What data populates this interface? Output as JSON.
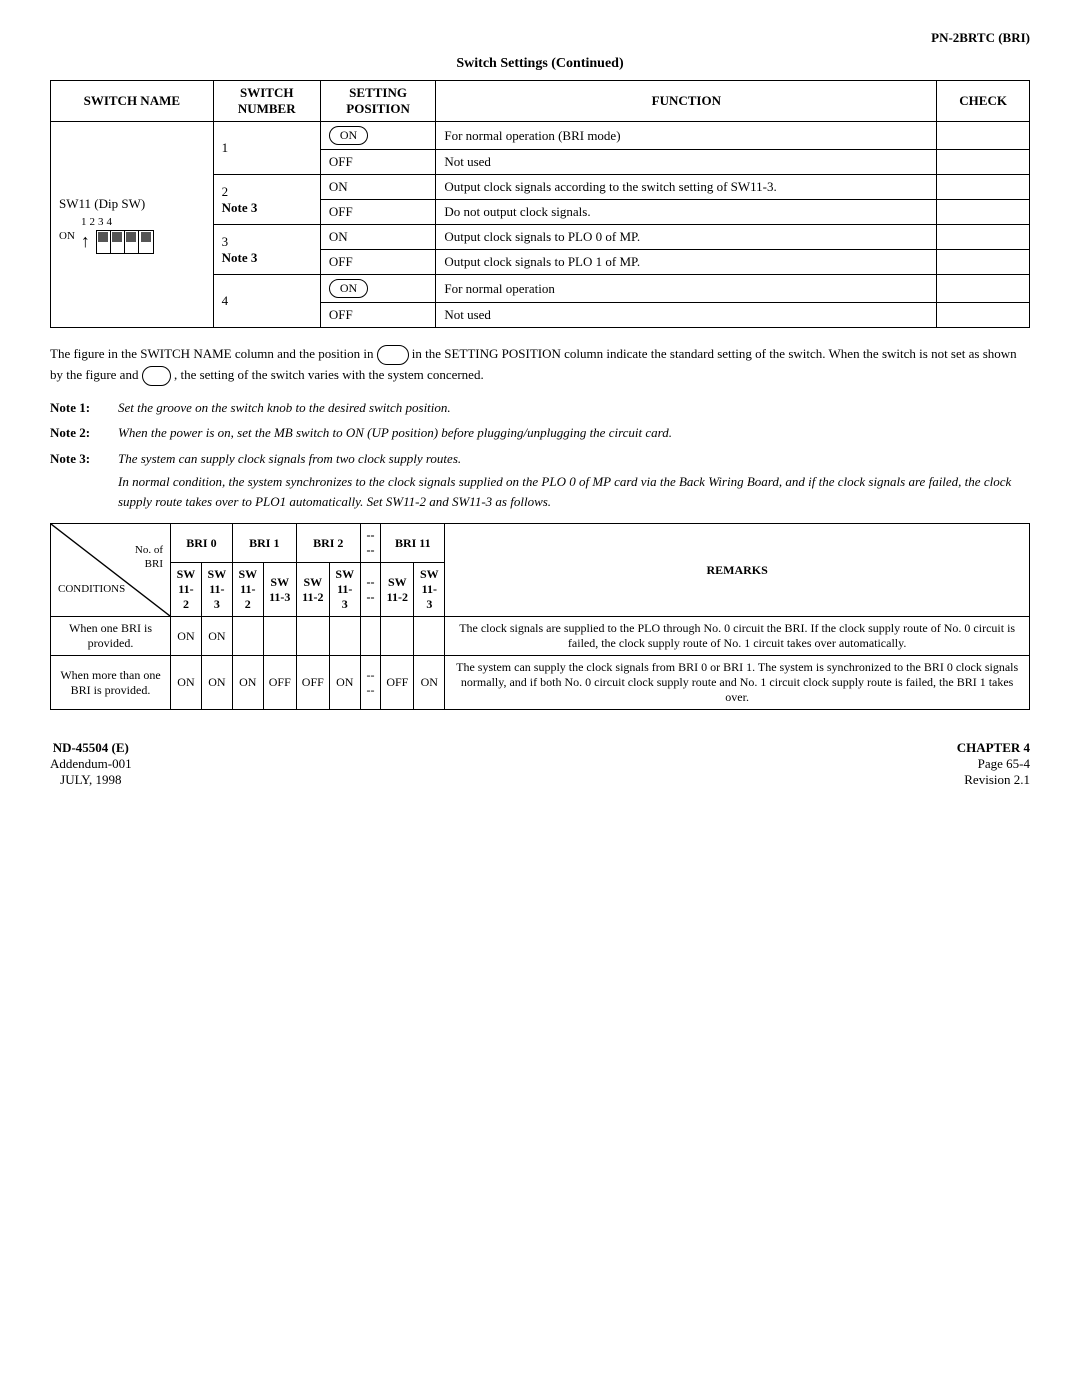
{
  "header": {
    "title": "PN-2BRTC (BRI)"
  },
  "section_title": "Switch Settings (Continued)",
  "switch_table": {
    "headers": [
      "SWITCH NAME",
      "SWITCH NUMBER",
      "SETTING POSITION",
      "FUNCTION",
      "CHECK"
    ],
    "switch_name": "SW11 (Dip SW)",
    "rows": [
      {
        "number": "1",
        "number_note": "",
        "positions": [
          {
            "pos": "ON",
            "circled": true,
            "function": "For normal operation (BRI mode)"
          },
          {
            "pos": "OFF",
            "circled": false,
            "function": "Not used"
          }
        ]
      },
      {
        "number": "2",
        "number_note": "Note 3",
        "positions": [
          {
            "pos": "ON",
            "circled": false,
            "function": "Output clock signals according to the switch setting of SW11-3."
          },
          {
            "pos": "OFF",
            "circled": false,
            "function": "Do not output clock signals."
          }
        ]
      },
      {
        "number": "3",
        "number_note": "Note 3",
        "positions": [
          {
            "pos": "ON",
            "circled": false,
            "function": "Output clock signals to PLO 0 of MP."
          },
          {
            "pos": "OFF",
            "circled": false,
            "function": "Output clock signals to PLO 1 of MP."
          }
        ]
      },
      {
        "number": "4",
        "number_note": "",
        "positions": [
          {
            "pos": "ON",
            "circled": true,
            "function": "For normal operation"
          },
          {
            "pos": "OFF",
            "circled": false,
            "function": "Not used"
          }
        ]
      }
    ]
  },
  "footnote_para": "The figure in the SWITCH NAME column and the position in",
  "footnote_para2": "in the SETTING POSITION column indicate the standard setting of the switch. When the switch is not set as shown by the figure and",
  "footnote_para3": ", the setting of the switch varies with the system concerned.",
  "notes": [
    {
      "label": "Note 1:",
      "text": "Set the groove on the switch knob to the desired switch position."
    },
    {
      "label": "Note 2:",
      "text": "When the power is on, set the MB switch to ON (UP position) before plugging/unplugging the circuit card."
    },
    {
      "label": "Note 3:",
      "text_line1": "The system can supply clock signals from two clock supply routes.",
      "text_line2": "In normal condition, the system synchronizes to the clock signals supplied on the PLO 0 of MP card via the Back Wiring Board, and if the clock signals are failed, the clock supply route takes over to PLO1 automatically. Set SW11-2 and SW11-3 as follows."
    }
  ],
  "bri_table": {
    "diagonal_top": "No. of BRI",
    "diagonal_bottom": "CONDITIONS",
    "sw_label": "SW",
    "groups": [
      {
        "label": "BRI  0",
        "col1": "SW\n11-2",
        "col2": "SW\n11-3"
      },
      {
        "label": "BRI  1",
        "col1": "SW\n11-2",
        "col2": "SW\n11-3"
      },
      {
        "label": "BRI  2",
        "col1": "SW\n11-2",
        "col2": "SW\n11-3"
      },
      {
        "label": "----",
        "col1": "----",
        "col2": null
      },
      {
        "label": "BRI  11",
        "col1": "SW\n11-2",
        "col2": "SW\n11-3"
      }
    ],
    "remarks_header": "REMARKS",
    "rows": [
      {
        "condition": "When one BRI is provided.",
        "bri0_sw112": "ON",
        "bri0_sw113": "ON",
        "bri1_sw112": "",
        "bri1_sw113": "",
        "bri2_sw112": "",
        "bri2_sw113": "",
        "dash": "",
        "bri11_sw112": "",
        "bri11_sw113": "",
        "remarks": "The clock signals are supplied to the PLO through No. 0 circuit the BRI. If the clock supply route of No. 0 circuit is failed, the clock supply route of No. 1 circuit takes over automatically."
      },
      {
        "condition": "When more than one BRI is provided.",
        "bri0_sw112": "ON",
        "bri0_sw113": "ON",
        "bri1_sw112": "ON",
        "bri1_sw113": "OFF",
        "bri2_sw112": "OFF",
        "bri2_sw113": "ON",
        "dash": "----",
        "bri11_sw112": "OFF",
        "bri11_sw113": "ON",
        "remarks": "The system can supply the clock signals from BRI 0 or BRI 1. The system is synchronized to the BRI 0 clock signals normally, and if both No. 0 circuit clock supply route and No. 1 circuit clock supply route is failed, the BRI 1 takes over."
      }
    ]
  },
  "footer": {
    "left_line1": "ND-45504 (E)",
    "left_line2": "Addendum-001",
    "left_line3": "JULY, 1998",
    "right_line1": "CHAPTER 4",
    "right_line2": "Page 65-4",
    "right_line3": "Revision 2.1"
  }
}
